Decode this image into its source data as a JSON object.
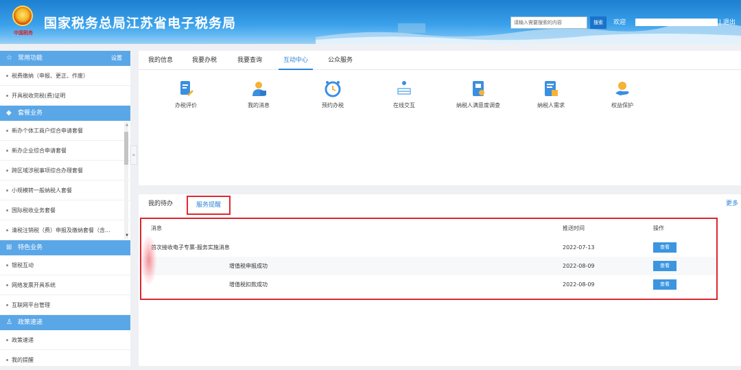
{
  "header": {
    "site_title": "国家税务总局江苏省电子税务局",
    "emblem_sub": "中国税务",
    "search_placeholder": "请输入需要搜索的内容",
    "search_button": "搜索",
    "welcome": "欢迎",
    "logout": "| 退出"
  },
  "sidebar": {
    "sections": [
      {
        "title": "常用功能",
        "icon": "star-icon",
        "settings": "设置",
        "items": [
          "税费缴纳（申报、更正、作废）",
          "开具税收完税(费)证明"
        ]
      },
      {
        "title": "套餐业务",
        "icon": "package-icon",
        "items": [
          "新办个体工商户综合申请套餐",
          "新办企业综合申请套餐",
          "跨区域涉税事项综合办理套餐",
          "小规模转一般纳税人套餐",
          "国际税收业务套餐",
          "清税注销税（费）申报及缴纳套餐（含..."
        ]
      },
      {
        "title": "特色业务",
        "icon": "grid-icon",
        "items": [
          "银税互动",
          "网络发票开具系统",
          "互联网平台管理"
        ]
      },
      {
        "title": "政策速递",
        "icon": "person-icon",
        "items": [
          "政策速递",
          "我的提醒"
        ]
      }
    ]
  },
  "tabs": [
    "我的信息",
    "我要办税",
    "我要查询",
    "互动中心",
    "公众服务"
  ],
  "active_tab": "互动中心",
  "apps": [
    {
      "label": "办税评价",
      "icon": "document-edit-icon"
    },
    {
      "label": "我的消息",
      "icon": "user-message-icon"
    },
    {
      "label": "预约办税",
      "icon": "clock-icon"
    },
    {
      "label": "在线交互",
      "icon": "keyboard-icon"
    },
    {
      "label": "纳税人满意度调查",
      "icon": "survey-icon"
    },
    {
      "label": "纳税人需求",
      "icon": "requirement-doc-icon"
    },
    {
      "label": "权益保护",
      "icon": "hand-protect-icon"
    }
  ],
  "bottom_tabs": {
    "todo": "我的待办",
    "reminder": "服务提醒",
    "more": "更多"
  },
  "table": {
    "headers": {
      "message": "消息",
      "time": "推送时间",
      "op": "操作"
    },
    "rows": [
      {
        "message": "首次接收电子专票-服务实施消息",
        "time": "2022-07-13",
        "action": "查看"
      },
      {
        "message": "增值税申报成功",
        "time": "2022-08-09",
        "action": "查看"
      },
      {
        "message": "增值税扣款成功",
        "time": "2022-08-09",
        "action": "查看"
      }
    ]
  },
  "colors": {
    "accent": "#2b83d8",
    "sidebar_head": "#5aa7e8",
    "highlight_border": "#e1262d"
  }
}
